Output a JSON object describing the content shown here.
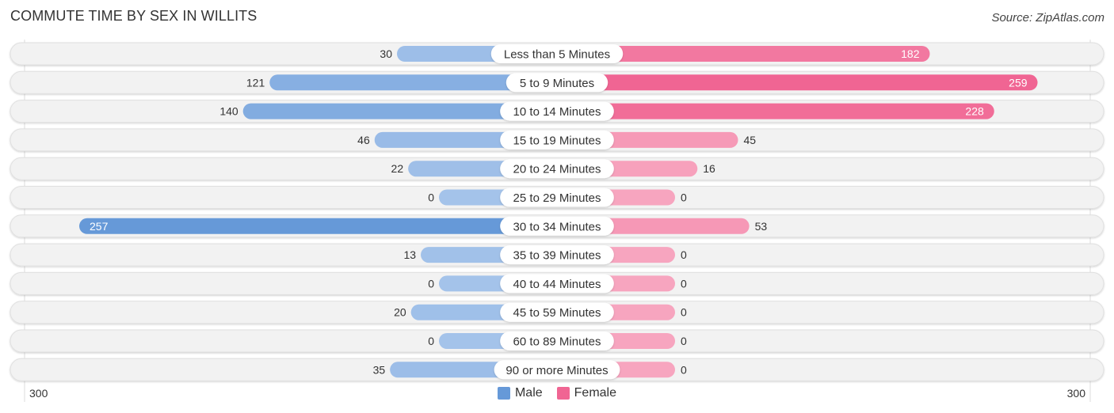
{
  "title": "COMMUTE TIME BY SEX IN WILLITS",
  "source": "Source: ZipAtlas.com",
  "colors": {
    "male_dark": "#6699D8",
    "male_light": "#A4C3EA",
    "female_dark": "#F06593",
    "female_light": "#F7A5BF",
    "track": "#F2F2F2"
  },
  "chart_data": {
    "type": "bar",
    "orientation": "horizontal-diverging",
    "title": "COMMUTE TIME BY SEX IN WILLITS",
    "categories": [
      "Less than 5 Minutes",
      "5 to 9 Minutes",
      "10 to 14 Minutes",
      "15 to 19 Minutes",
      "20 to 24 Minutes",
      "25 to 29 Minutes",
      "30 to 34 Minutes",
      "35 to 39 Minutes",
      "40 to 44 Minutes",
      "45 to 59 Minutes",
      "60 to 89 Minutes",
      "90 or more Minutes"
    ],
    "series": [
      {
        "name": "Male",
        "values": [
          30,
          121,
          140,
          46,
          22,
          0,
          257,
          13,
          0,
          20,
          0,
          35
        ]
      },
      {
        "name": "Female",
        "values": [
          182,
          259,
          228,
          45,
          16,
          0,
          53,
          0,
          0,
          0,
          0,
          0
        ]
      }
    ],
    "axis": {
      "left_label": "300",
      "right_label": "300",
      "range": [
        0,
        300
      ]
    },
    "legend": {
      "position": "bottom-center",
      "entries": [
        "Male",
        "Female"
      ]
    }
  }
}
